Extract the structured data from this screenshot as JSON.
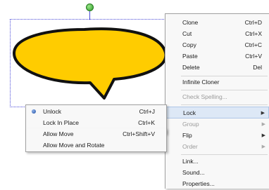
{
  "main_menu": {
    "items": [
      {
        "label": "Clone",
        "shortcut": "Ctrl+D"
      },
      {
        "label": "Cut",
        "shortcut": "Ctrl+X"
      },
      {
        "label": "Copy",
        "shortcut": "Ctrl+C"
      },
      {
        "label": "Paste",
        "shortcut": "Ctrl+V"
      },
      {
        "label": "Delete",
        "shortcut": "Del"
      },
      {
        "label": "Infinite Cloner"
      },
      {
        "label": "Check Spelling..."
      },
      {
        "label": "Lock"
      },
      {
        "label": "Group"
      },
      {
        "label": "Flip"
      },
      {
        "label": "Order"
      },
      {
        "label": "Link..."
      },
      {
        "label": "Sound..."
      },
      {
        "label": "Properties..."
      }
    ]
  },
  "lock_submenu": {
    "items": [
      {
        "label": "Unlock",
        "shortcut": "Ctrl+J"
      },
      {
        "label": "Lock In Place",
        "shortcut": "Ctrl+K"
      },
      {
        "label": "Allow Move",
        "shortcut": "Ctrl+Shift+V"
      },
      {
        "label": "Allow Move and Rotate"
      }
    ]
  },
  "colors": {
    "bubble_fill": "#ffcc00",
    "selection_border": "#4a4ad8",
    "highlight": "#dde8f6"
  }
}
